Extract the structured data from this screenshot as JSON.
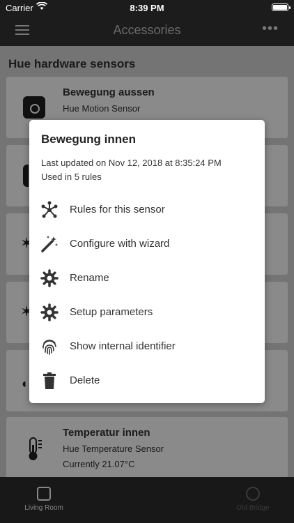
{
  "status_bar": {
    "carrier": "Carrier",
    "time": "8:39 PM"
  },
  "nav": {
    "title": "Accessories",
    "more": "•••"
  },
  "section_title": "Hue hardware sensors",
  "cards": [
    {
      "title": "Bewegung aussen",
      "subtitle": "Hue Motion Sensor"
    },
    {
      "title": "Temperatur innen",
      "subtitle": "Hue Temperature Sensor",
      "value": "Currently 21.07°C"
    }
  ],
  "tabs": [
    {
      "label": "Living Room"
    },
    {
      "label": "Old Bridge"
    }
  ],
  "modal": {
    "title": "Bewegung innen",
    "last_updated": "Last updated on Nov 12, 2018 at 8:35:24 PM",
    "used_in": "Used in 5 rules",
    "items": [
      {
        "label": "Rules for this sensor",
        "icon": "network-icon"
      },
      {
        "label": "Configure with wizard",
        "icon": "magic-wand-icon"
      },
      {
        "label": "Rename",
        "icon": "gear-icon"
      },
      {
        "label": "Setup parameters",
        "icon": "gear-icon"
      },
      {
        "label": "Show internal identifier",
        "icon": "fingerprint-icon"
      },
      {
        "label": "Delete",
        "icon": "trash-icon"
      }
    ]
  }
}
